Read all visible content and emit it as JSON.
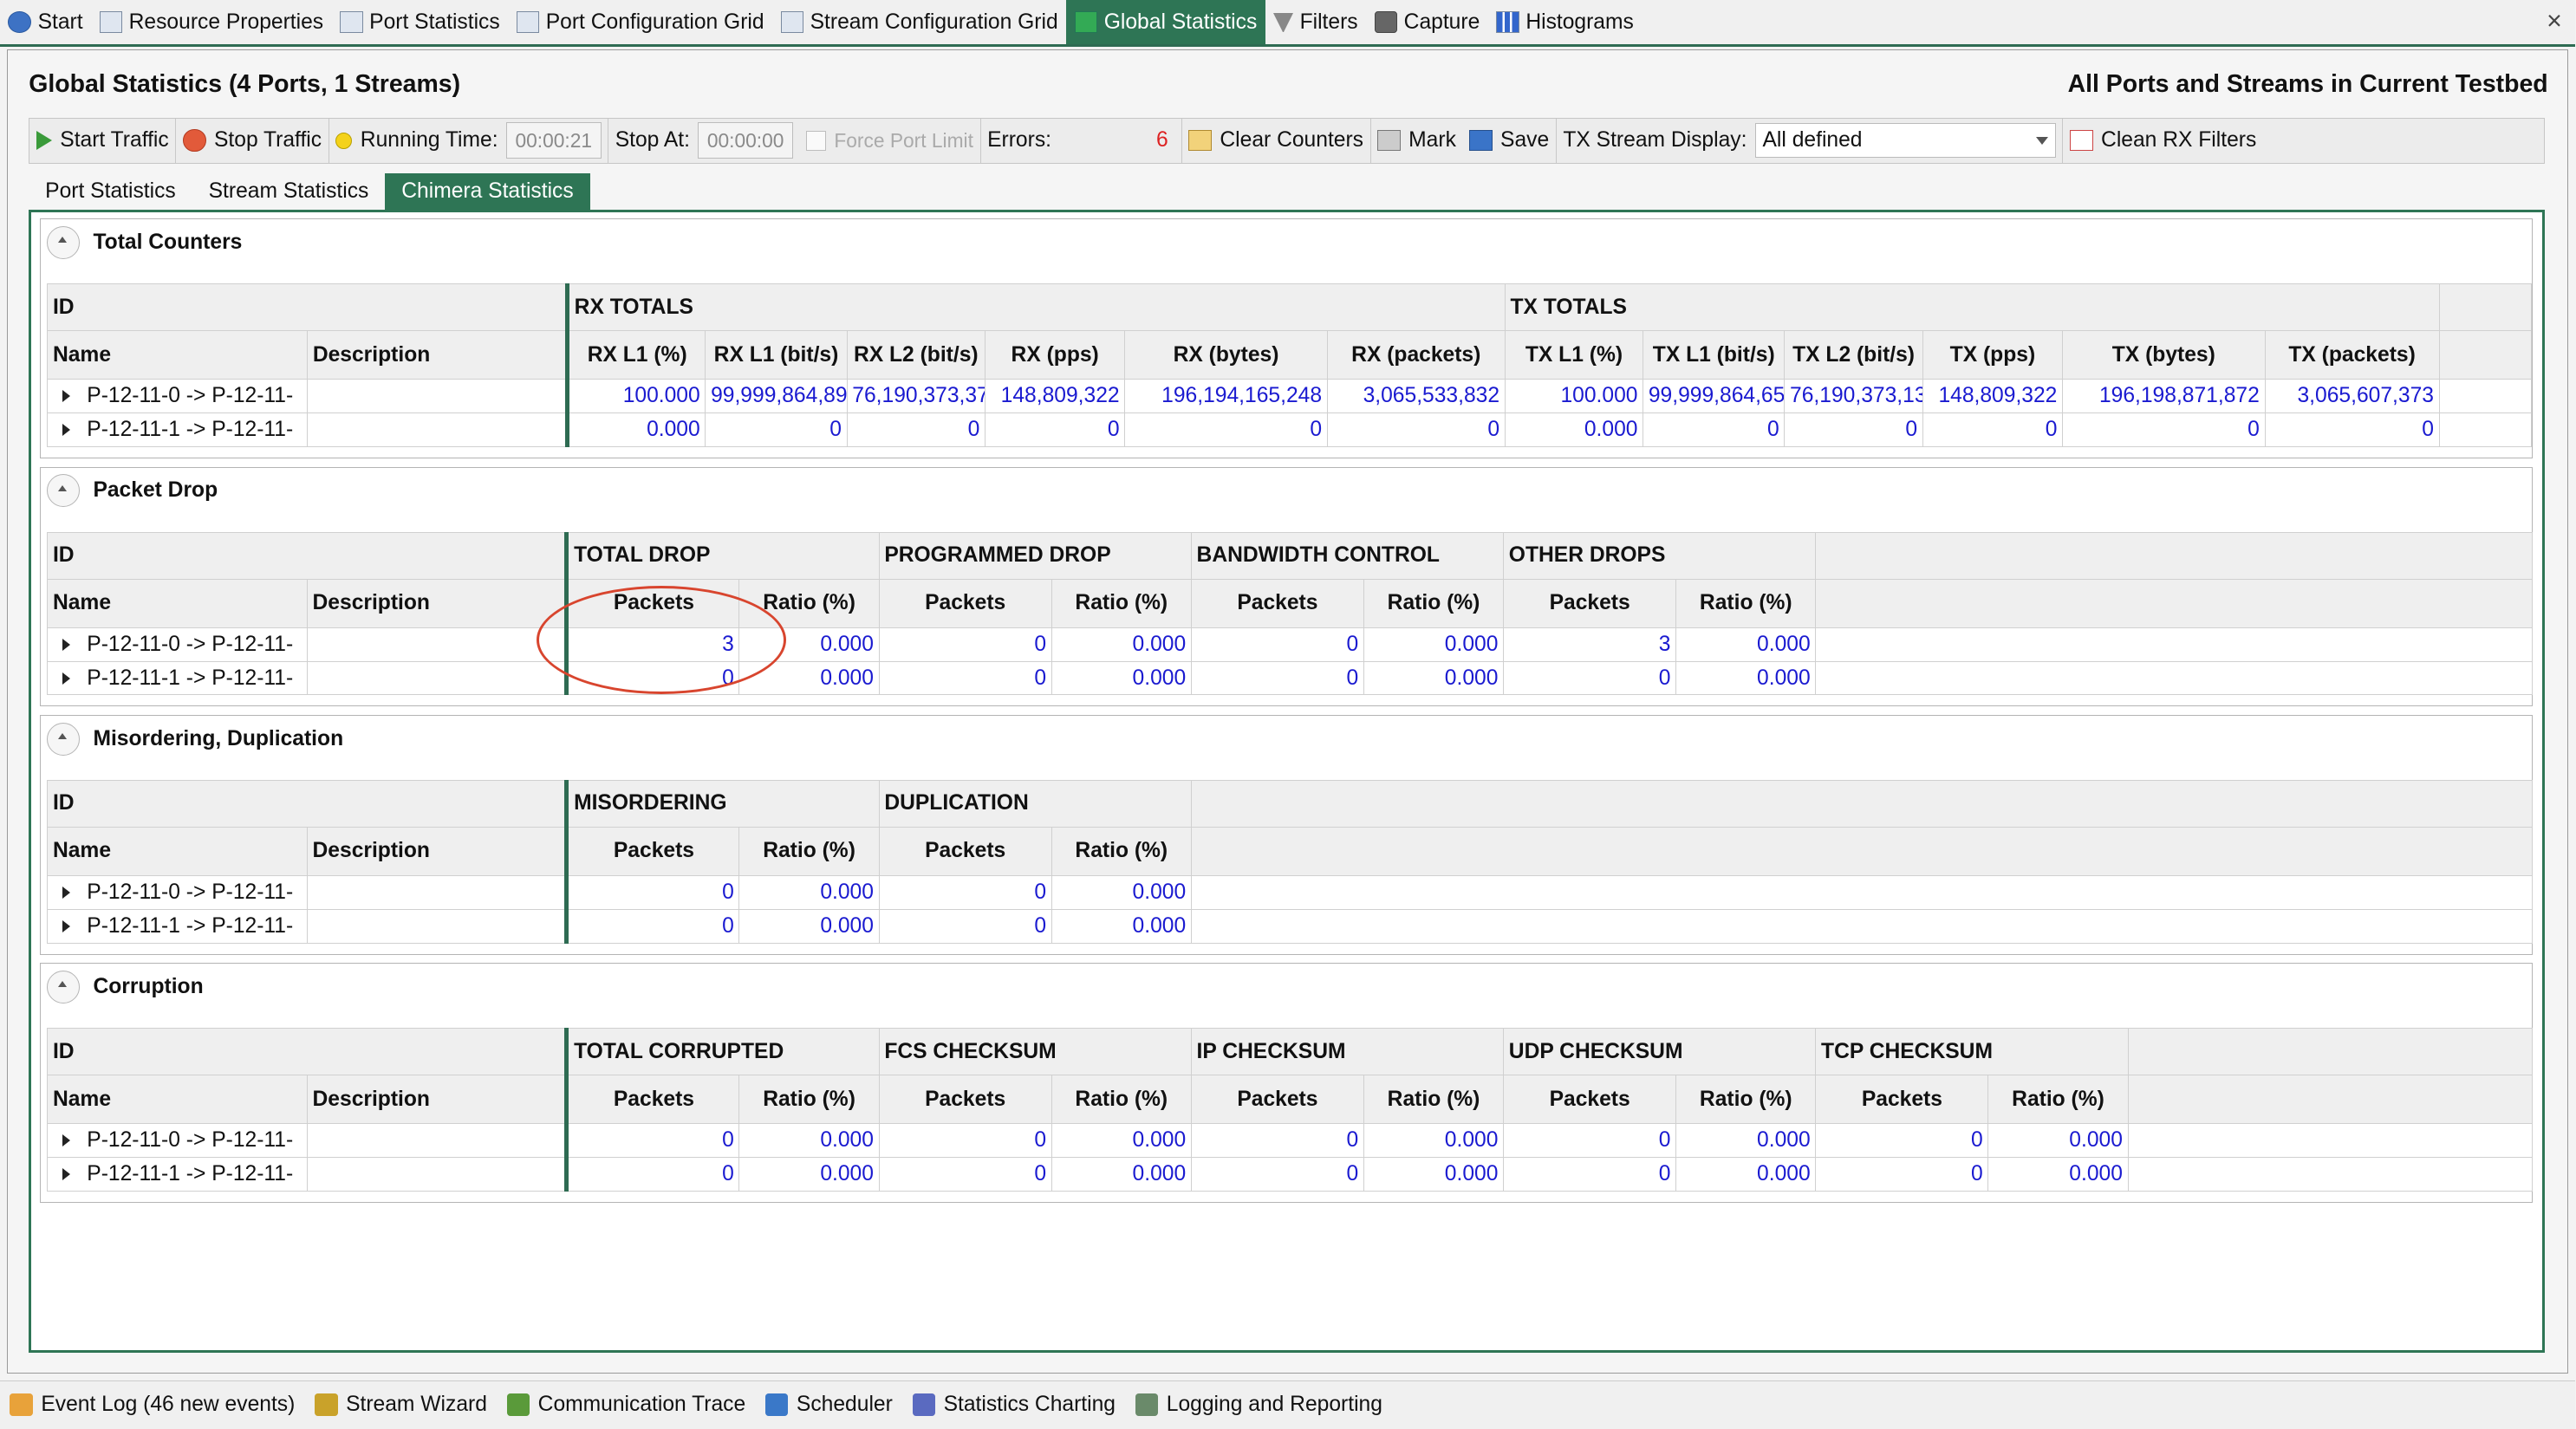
{
  "top_tabs": [
    {
      "label": "Start",
      "icon": "info-icon"
    },
    {
      "label": "Resource Properties",
      "icon": "properties-icon"
    },
    {
      "label": "Port Statistics",
      "icon": "table-icon"
    },
    {
      "label": "Port Configuration Grid",
      "icon": "grid-icon"
    },
    {
      "label": "Stream Configuration Grid",
      "icon": "stream-grid-icon"
    },
    {
      "label": "Global Statistics",
      "icon": "chart-icon",
      "active": true
    },
    {
      "label": "Filters",
      "icon": "filter-icon"
    },
    {
      "label": "Capture",
      "icon": "camera-icon"
    },
    {
      "label": "Histograms",
      "icon": "histogram-icon"
    }
  ],
  "close_glyph": "×",
  "panel": {
    "title": "Global Statistics (4 Ports, 1 Streams)",
    "title_right": "All Ports and Streams in Current Testbed"
  },
  "toolbar": {
    "start_traffic": "Start Traffic",
    "stop_traffic": "Stop Traffic",
    "running_time_label": "Running Time:",
    "running_time_value": "00:00:21",
    "stop_at_label": "Stop At:",
    "stop_at_value": "00:00:00",
    "force_port_limit": "Force Port Limit",
    "errors_label": "Errors:",
    "errors_value": "6",
    "clear_counters": "Clear Counters",
    "mark": "Mark",
    "save": "Save",
    "tx_stream_display_label": "TX Stream Display:",
    "tx_stream_display_value": "All defined",
    "clean_rx_filters": "Clean RX Filters"
  },
  "sub_tabs": [
    {
      "label": "Port Statistics"
    },
    {
      "label": "Stream Statistics"
    },
    {
      "label": "Chimera Statistics",
      "active": true
    }
  ],
  "sections": {
    "total_counters": {
      "title": "Total Counters",
      "id_label": "ID",
      "name_label": "Name",
      "desc_label": "Description",
      "groups": [
        "RX TOTALS",
        "TX TOTALS"
      ],
      "cols": [
        "RX L1 (%)",
        "RX L1 (bit/s)",
        "RX L2 (bit/s)",
        "RX (pps)",
        "RX (bytes)",
        "RX (packets)",
        "TX L1 (%)",
        "TX L1 (bit/s)",
        "TX L2 (bit/s)",
        "TX (pps)",
        "TX (bytes)",
        "TX (packets)"
      ],
      "rows": [
        {
          "name": "P-12-11-0 -> P-12-11-",
          "desc": "",
          "values": [
            "100.000",
            "99,999,864,89",
            "76,190,373,37",
            "148,809,322",
            "196,194,165,248",
            "3,065,533,832",
            "100.000",
            "99,999,864,65",
            "76,190,373,13",
            "148,809,322",
            "196,198,871,872",
            "3,065,607,373"
          ]
        },
        {
          "name": "P-12-11-1 -> P-12-11-",
          "desc": "",
          "values": [
            "0.000",
            "0",
            "0",
            "0",
            "0",
            "0",
            "0.000",
            "0",
            "0",
            "0",
            "0",
            "0"
          ]
        }
      ]
    },
    "packet_drop": {
      "title": "Packet Drop",
      "id_label": "ID",
      "name_label": "Name",
      "desc_label": "Description",
      "groups": [
        "TOTAL DROP",
        "PROGRAMMED DROP",
        "BANDWIDTH CONTROL",
        "OTHER DROPS"
      ],
      "sub": [
        "Packets",
        "Ratio (%)"
      ],
      "rows": [
        {
          "name": "P-12-11-0 -> P-12-11-",
          "desc": "",
          "values": [
            "3",
            "0.000",
            "0",
            "0.000",
            "0",
            "0.000",
            "3",
            "0.000"
          ]
        },
        {
          "name": "P-12-11-1 -> P-12-11-",
          "desc": "",
          "values": [
            "0",
            "0.000",
            "0",
            "0.000",
            "0",
            "0.000",
            "0",
            "0.000"
          ]
        }
      ]
    },
    "misordering": {
      "title": "Misordering, Duplication",
      "id_label": "ID",
      "name_label": "Name",
      "desc_label": "Description",
      "groups": [
        "MISORDERING",
        "DUPLICATION"
      ],
      "sub": [
        "Packets",
        "Ratio (%)"
      ],
      "rows": [
        {
          "name": "P-12-11-0 -> P-12-11-",
          "desc": "",
          "values": [
            "0",
            "0.000",
            "0",
            "0.000"
          ]
        },
        {
          "name": "P-12-11-1 -> P-12-11-",
          "desc": "",
          "values": [
            "0",
            "0.000",
            "0",
            "0.000"
          ]
        }
      ]
    },
    "corruption": {
      "title": "Corruption",
      "id_label": "ID",
      "name_label": "Name",
      "desc_label": "Description",
      "groups": [
        "TOTAL CORRUPTED",
        "FCS CHECKSUM",
        "IP CHECKSUM",
        "UDP CHECKSUM",
        "TCP CHECKSUM"
      ],
      "sub": [
        "Packets",
        "Ratio (%)"
      ],
      "rows": [
        {
          "name": "P-12-11-0 -> P-12-11-",
          "desc": "",
          "values": [
            "0",
            "0.000",
            "0",
            "0.000",
            "0",
            "0.000",
            "0",
            "0.000",
            "0",
            "0.000"
          ]
        },
        {
          "name": "P-12-11-1 -> P-12-11-",
          "desc": "",
          "values": [
            "0",
            "0.000",
            "0",
            "0.000",
            "0",
            "0.000",
            "0",
            "0.000",
            "0",
            "0.000"
          ]
        }
      ]
    }
  },
  "bottom_tabs": [
    {
      "label": "Event Log (46 new events)",
      "icon": "event-log-icon"
    },
    {
      "label": "Stream Wizard",
      "icon": "wand-icon"
    },
    {
      "label": "Communication Trace",
      "icon": "gear-icon"
    },
    {
      "label": "Scheduler",
      "icon": "clock-icon"
    },
    {
      "label": "Statistics Charting",
      "icon": "chart-icon"
    },
    {
      "label": "Logging and Reporting",
      "icon": "report-icon"
    }
  ],
  "colors": {
    "accent": "#2e7555",
    "value_blue": "#1a1ad0",
    "error_red": "#d22",
    "annotation_red": "#d8452e"
  }
}
